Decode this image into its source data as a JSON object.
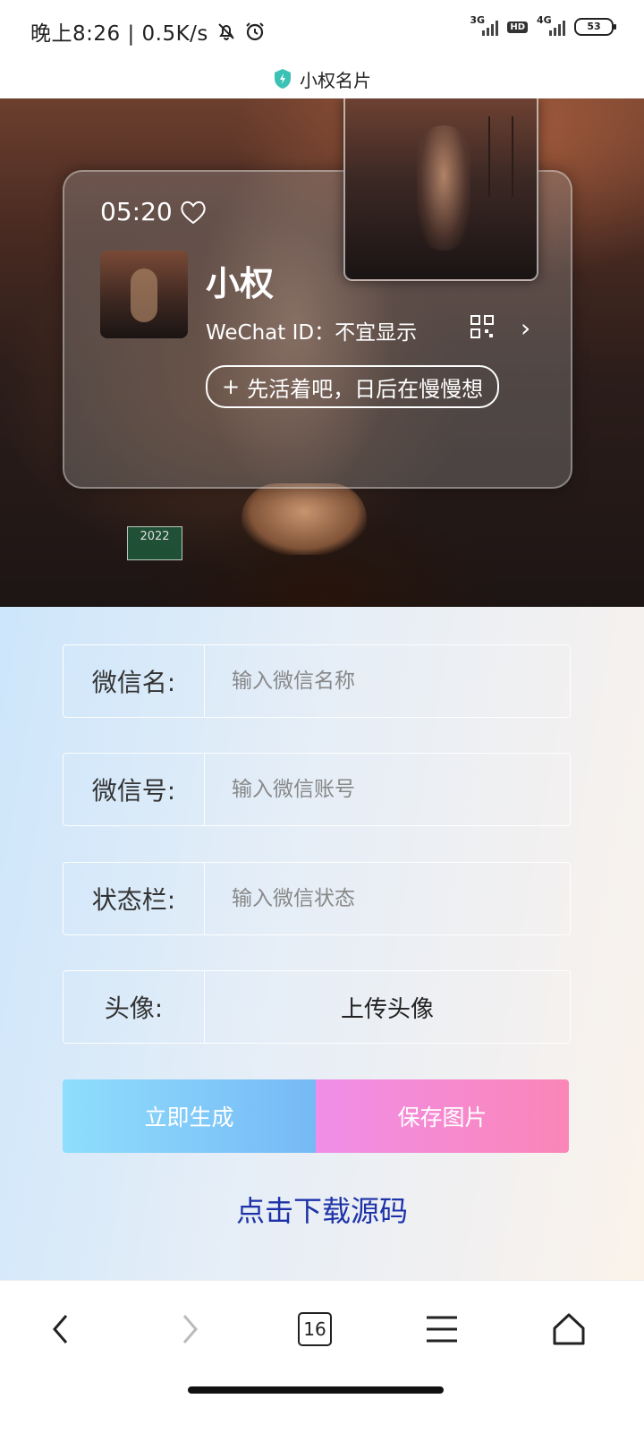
{
  "status_bar": {
    "time_speed": "晚上8:26 | 0.5K/s",
    "net1": "3G",
    "hd": "HD",
    "net2": "4G",
    "battery": "53"
  },
  "app": {
    "title": "小权名片"
  },
  "card": {
    "time": "05:20",
    "name": "小权",
    "wechat_id": "WeChat ID：不宜显示",
    "status": "先活着吧，日后在慢慢想",
    "plate_text": "2022"
  },
  "form": {
    "name_label": "微信名:",
    "name_placeholder": "输入微信名称",
    "id_label": "微信号:",
    "id_placeholder": "输入微信账号",
    "status_label": "状态栏:",
    "status_placeholder": "输入微信状态",
    "avatar_label": "头像:",
    "avatar_upload": "上传头像",
    "generate": "立即生成",
    "save": "保存图片",
    "download": "点击下载源码"
  },
  "nav": {
    "tabs": "16"
  }
}
